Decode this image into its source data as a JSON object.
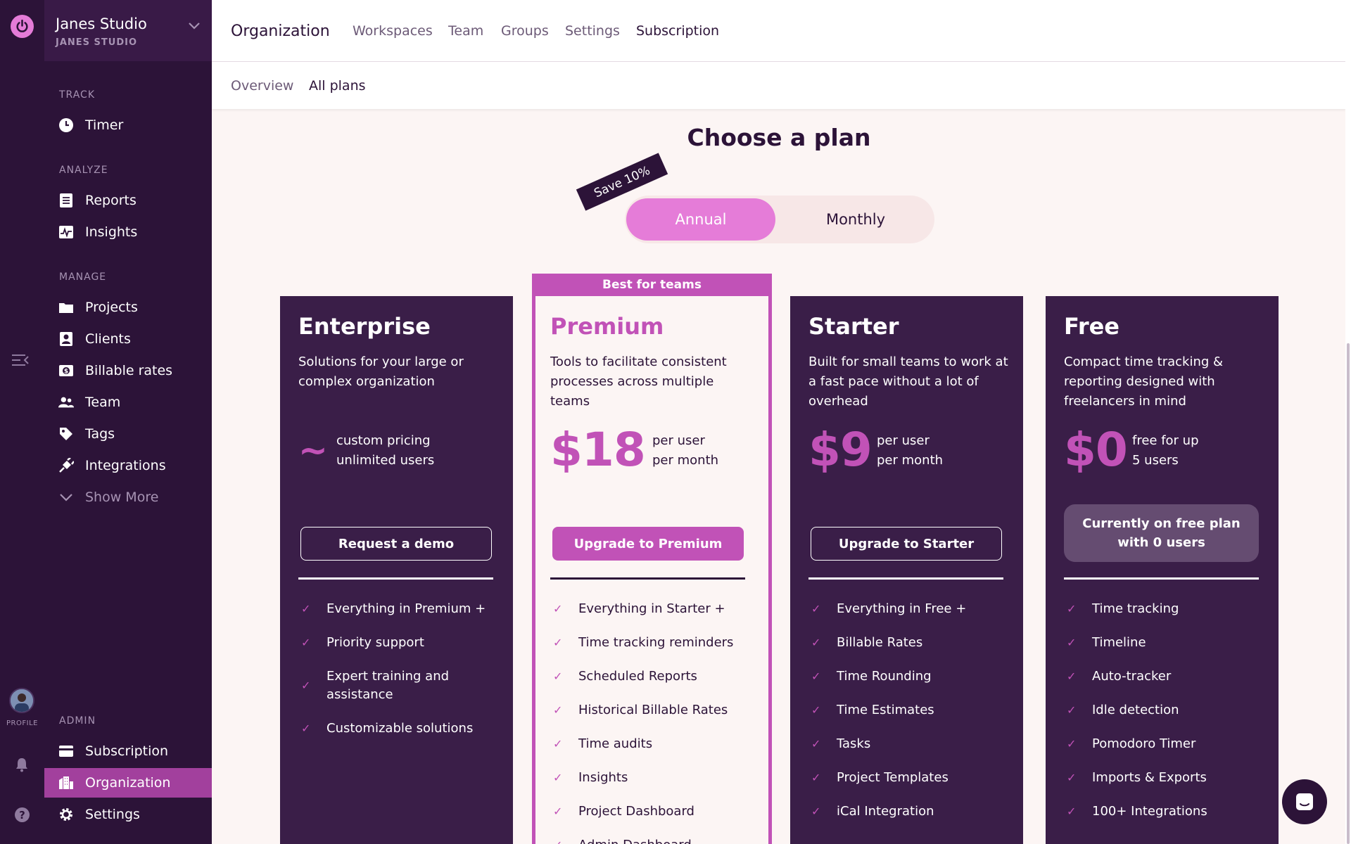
{
  "rail": {
    "profile_label": "PROFILE"
  },
  "workspace": {
    "name": "Janes Studio",
    "subtitle": "JANES STUDIO"
  },
  "sidebar": {
    "sections": {
      "track": "TRACK",
      "analyze": "ANALYZE",
      "manage": "MANAGE",
      "admin": "ADMIN"
    },
    "items": {
      "timer": "Timer",
      "reports": "Reports",
      "insights": "Insights",
      "projects": "Projects",
      "clients": "Clients",
      "billable_rates": "Billable rates",
      "team": "Team",
      "tags": "Tags",
      "integrations": "Integrations",
      "show_more": "Show More",
      "subscription": "Subscription",
      "organization": "Organization",
      "settings": "Settings"
    }
  },
  "header": {
    "title": "Organization",
    "tabs": [
      "Workspaces",
      "Team",
      "Groups",
      "Settings",
      "Subscription"
    ],
    "active_tab": "Subscription",
    "subtabs": [
      "Overview",
      "All plans"
    ],
    "active_subtab": "All plans"
  },
  "main": {
    "heading": "Choose a plan",
    "save_badge": "Save 10%",
    "billing_options": [
      "Annual",
      "Monthly"
    ],
    "selected_billing": "Annual",
    "best_badge": "Best for teams"
  },
  "plans": [
    {
      "name": "Enterprise",
      "description": "Solutions for your large or complex organization",
      "price": "~",
      "price_note_1": "custom pricing",
      "price_note_2": "unlimited users",
      "button": "Request a demo",
      "features": [
        "Everything in Premium +",
        "Priority support",
        "Expert training and assistance",
        "Customizable solutions"
      ]
    },
    {
      "name": "Premium",
      "description": "Tools to facilitate consistent processes across multiple teams",
      "price": "$18",
      "price_note_1": "per user",
      "price_note_2": "per month",
      "button": "Upgrade to Premium",
      "features": [
        "Everything in Starter +",
        "Time tracking reminders",
        "Scheduled Reports",
        "Historical Billable Rates",
        "Time audits",
        "Insights",
        "Project Dashboard",
        "Admin Dashboard"
      ]
    },
    {
      "name": "Starter",
      "description": "Built for small teams to work at a fast pace without a lot of overhead",
      "price": "$9",
      "price_note_1": "per user",
      "price_note_2": "per month",
      "button": "Upgrade to Starter",
      "features": [
        "Everything in Free +",
        "Billable Rates",
        "Time Rounding",
        "Time Estimates",
        "Tasks",
        "Project Templates",
        "iCal Integration"
      ]
    },
    {
      "name": "Free",
      "description": "Compact time tracking & reporting designed with freelancers in mind",
      "price": "$0",
      "price_note_1": "free for up",
      "price_note_2": "5 users",
      "button": "Currently on free plan with 0 users",
      "features": [
        "Time tracking",
        "Timeline",
        "Auto-tracker",
        "Idle detection",
        "Pomodoro Timer",
        "Imports & Exports",
        "100+ Integrations"
      ]
    }
  ],
  "colors": {
    "sidebar_bg": "#2c1338",
    "accent": "#c152b7",
    "accent_light": "#e57cd8",
    "page_bg": "#fcf5f4",
    "card_bg": "#3a1e48"
  }
}
